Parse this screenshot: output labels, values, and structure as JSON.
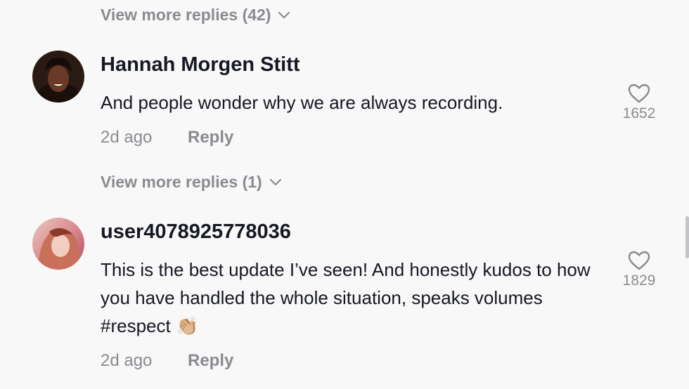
{
  "top_replies": {
    "label": "View more replies (42)"
  },
  "comments": [
    {
      "username": "Hannah Morgen Stitt",
      "text": "And people wonder why we are always recording.",
      "emoji": "",
      "time": "2d ago",
      "reply_label": "Reply",
      "likes": "1652",
      "more_replies_label": "View more replies (1)"
    },
    {
      "username": "user4078925778036",
      "text": "This is the best update I’ve seen! And honestly kudos to how you have handled the whole situation, speaks volumes #respect",
      "emoji": "👏🏼",
      "time": "2d ago",
      "reply_label": "Reply",
      "likes": "1829"
    }
  ],
  "colors": {
    "background": "#f8f8f8",
    "primary_text": "#161823",
    "secondary_text": "#8a8b91"
  },
  "icons": [
    "chevron-down-icon",
    "heart-icon"
  ]
}
